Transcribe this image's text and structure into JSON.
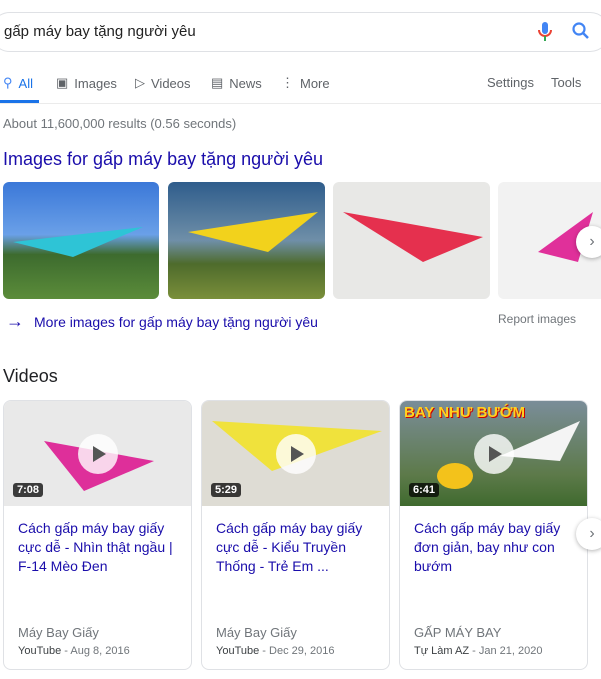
{
  "search": {
    "query": "gấp máy bay tặng người yêu"
  },
  "tabs": [
    {
      "label": "All",
      "icon": "search-icon"
    },
    {
      "label": "Images",
      "icon": "image-icon"
    },
    {
      "label": "Videos",
      "icon": "play-icon"
    },
    {
      "label": "News",
      "icon": "news-icon"
    },
    {
      "label": "More",
      "icon": "more-vert-icon"
    }
  ],
  "settings_label": "Settings",
  "tools_label": "Tools",
  "stats": "About 11,600,000 results (0.56 seconds)",
  "images": {
    "title": "Images for gấp máy bay tặng người yêu",
    "more_label": "More images for gấp máy bay tặng người yêu",
    "report_label": "Report images"
  },
  "videos": {
    "title": "Videos",
    "items": [
      {
        "duration": "7:08",
        "title": "Cách gấp máy bay giấy cực dễ - Nhìn thật ngầu | F-14 Mèo Đen",
        "channel": "Máy Bay Giấy",
        "source": "YouTube",
        "date": "Aug 8, 2016"
      },
      {
        "duration": "5:29",
        "title": "Cách gấp máy bay giấy cực dễ - Kiểu Truyền Thống - Trẻ Em ...",
        "channel": "Máy Bay Giấy",
        "source": "YouTube",
        "date": "Dec 29, 2016"
      },
      {
        "duration": "6:41",
        "title": "Cách gấp máy bay giấy đơn giản, bay như con bướm",
        "channel": "GẤP MÁY BAY",
        "source": "Tự Làm AZ",
        "date": "Jan 21, 2020",
        "thumb_text": "BAY NHƯ BƯỚM"
      }
    ]
  },
  "colors": {
    "link": "#1a0dab",
    "accent": "#1a73e8"
  }
}
